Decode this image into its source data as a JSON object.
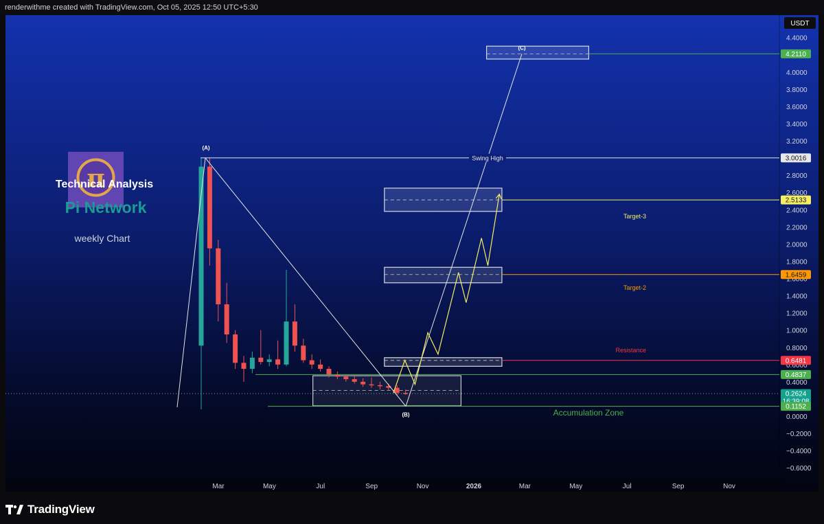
{
  "header": {
    "attribution": "renderwithme created with TradingView.com, Oct 05, 2025 12:50 UTC+5:30"
  },
  "footer": {
    "brand": "TradingView"
  },
  "overlay": {
    "title_line1": "Technical Analysis",
    "title_line2": "Pi Network",
    "subtitle": "weekly Chart",
    "logo_glyph": "π"
  },
  "colors": {
    "candle_up": "#26a69a",
    "candle_down": "#ef5350",
    "projection": "#f5ee62",
    "zone_line": "#4caf50",
    "target_box": "#d7dae3",
    "title_teal": "#1b9c92"
  },
  "chart_data": {
    "type": "candlestick",
    "currency_label": "USDT",
    "y_ticks": [
      "4.4000",
      "4.2000",
      "4.0000",
      "3.8000",
      "3.6000",
      "3.4000",
      "3.2000",
      "3.0000",
      "2.8000",
      "2.6000",
      "2.4000",
      "2.2000",
      "2.0000",
      "1.8000",
      "1.6000",
      "1.4000",
      "1.2000",
      "1.0000",
      "0.8000",
      "0.6000",
      "0.4000",
      "0.2000",
      "0.0000",
      "−0.2000",
      "−0.4000",
      "−0.6000"
    ],
    "x_ticks": [
      {
        "label": "Mar",
        "t": 0.5,
        "bold": false
      },
      {
        "label": "May",
        "t": 2.5,
        "bold": false
      },
      {
        "label": "Jul",
        "t": 4.5,
        "bold": false
      },
      {
        "label": "Sep",
        "t": 6.5,
        "bold": false
      },
      {
        "label": "Nov",
        "t": 8.5,
        "bold": false
      },
      {
        "label": "2026",
        "t": 10.5,
        "bold": true
      },
      {
        "label": "Mar",
        "t": 12.5,
        "bold": false
      },
      {
        "label": "May",
        "t": 14.5,
        "bold": false
      },
      {
        "label": "Jul",
        "t": 16.5,
        "bold": false
      },
      {
        "label": "Sep",
        "t": 18.5,
        "bold": false
      },
      {
        "label": "Nov",
        "t": 20.5,
        "bold": false
      }
    ],
    "price_tags": [
      {
        "value": 4.211,
        "label": "4.2110",
        "bg": "#4caf50",
        "fg": "#ffffff"
      },
      {
        "value": 3.0016,
        "label": "3.0016",
        "bg": "#e8e8e8",
        "fg": "#131722"
      },
      {
        "value": 2.5133,
        "label": "2.5133",
        "bg": "#f5ee62",
        "fg": "#131722"
      },
      {
        "value": 1.6459,
        "label": "1.6459",
        "bg": "#ff9800",
        "fg": "#131722"
      },
      {
        "value": 0.6481,
        "label": "0.6481",
        "bg": "#f23645",
        "fg": "#ffffff"
      },
      {
        "value": 0.4837,
        "label": "0.4837",
        "bg": "#4caf50",
        "fg": "#ffffff"
      },
      {
        "value": 0.2624,
        "label": "0.2624",
        "bg": "#14a28f",
        "fg": "#ffffff",
        "sub": "16:39:08"
      },
      {
        "value": 0.1152,
        "label": "0.1152",
        "bg": "#4caf50",
        "fg": "#ffffff"
      }
    ],
    "wave_points": [
      {
        "label": "(A)",
        "t": -0.2,
        "value": 3.0016
      },
      {
        "label": "(B)",
        "t": 6.8,
        "value": 0.1152
      },
      {
        "label": "(C)",
        "t": 11.6,
        "value": 4.211
      }
    ],
    "annotations": {
      "swing_high": "Swing High",
      "target3": "Target-3",
      "target2": "Target-2",
      "resistance": "Resistance",
      "accumulation": "Accumulation Zone"
    },
    "zones": [
      {
        "name": "target-c",
        "value": 4.211,
        "high": 4.3,
        "low": 4.15,
        "t_start": 11.0,
        "t_end": 15.0
      },
      {
        "name": "target-3",
        "value": 2.5133,
        "high": 2.65,
        "low": 2.38,
        "t_start": 7.0,
        "t_end": 11.6
      },
      {
        "name": "target-2",
        "value": 1.6459,
        "high": 1.73,
        "low": 1.55,
        "t_start": 7.0,
        "t_end": 11.6
      },
      {
        "name": "resistance",
        "value": 0.6481,
        "high": 0.68,
        "low": 0.58,
        "t_start": 7.0,
        "t_end": 11.6
      },
      {
        "name": "accumulation",
        "value": 0.3,
        "high": 0.47,
        "low": 0.12,
        "t_start": 4.2,
        "t_end": 10.0
      }
    ],
    "projection_path": [
      [
        7.35,
        0.27
      ],
      [
        7.8,
        0.65
      ],
      [
        8.2,
        0.37
      ],
      [
        8.7,
        0.97
      ],
      [
        9.1,
        0.72
      ],
      [
        9.9,
        1.67
      ],
      [
        10.2,
        1.32
      ],
      [
        10.8,
        2.07
      ],
      [
        11.05,
        1.75
      ],
      [
        11.5,
        2.58
      ]
    ],
    "candles_weekly": [
      {
        "o": 0.82,
        "h": 3.0,
        "l": 0.08,
        "c": 2.9
      },
      {
        "o": 2.9,
        "h": 3.0,
        "l": 1.75,
        "c": 1.95
      },
      {
        "o": 1.95,
        "h": 2.05,
        "l": 1.1,
        "c": 1.3
      },
      {
        "o": 1.3,
        "h": 1.55,
        "l": 0.85,
        "c": 0.95
      },
      {
        "o": 0.95,
        "h": 1.0,
        "l": 0.55,
        "c": 0.62
      },
      {
        "o": 0.62,
        "h": 0.7,
        "l": 0.4,
        "c": 0.55
      },
      {
        "o": 0.55,
        "h": 0.75,
        "l": 0.5,
        "c": 0.68
      },
      {
        "o": 0.68,
        "h": 1.0,
        "l": 0.6,
        "c": 0.63
      },
      {
        "o": 0.63,
        "h": 0.72,
        "l": 0.58,
        "c": 0.66
      },
      {
        "o": 0.66,
        "h": 0.88,
        "l": 0.55,
        "c": 0.6
      },
      {
        "o": 0.6,
        "h": 1.7,
        "l": 0.58,
        "c": 1.1
      },
      {
        "o": 1.1,
        "h": 1.3,
        "l": 0.75,
        "c": 0.82
      },
      {
        "o": 0.82,
        "h": 0.9,
        "l": 0.62,
        "c": 0.65
      },
      {
        "o": 0.65,
        "h": 0.72,
        "l": 0.55,
        "c": 0.6
      },
      {
        "o": 0.6,
        "h": 0.66,
        "l": 0.52,
        "c": 0.55
      },
      {
        "o": 0.55,
        "h": 0.58,
        "l": 0.45,
        "c": 0.48
      },
      {
        "o": 0.48,
        "h": 0.52,
        "l": 0.43,
        "c": 0.46
      },
      {
        "o": 0.46,
        "h": 0.48,
        "l": 0.4,
        "c": 0.43
      },
      {
        "o": 0.43,
        "h": 0.47,
        "l": 0.38,
        "c": 0.4
      },
      {
        "o": 0.4,
        "h": 0.44,
        "l": 0.34,
        "c": 0.37
      },
      {
        "o": 0.37,
        "h": 0.45,
        "l": 0.33,
        "c": 0.36
      },
      {
        "o": 0.36,
        "h": 0.4,
        "l": 0.31,
        "c": 0.35
      },
      {
        "o": 0.35,
        "h": 0.38,
        "l": 0.3,
        "c": 0.33
      },
      {
        "o": 0.33,
        "h": 0.36,
        "l": 0.24,
        "c": 0.27
      },
      {
        "o": 0.27,
        "h": 0.31,
        "l": 0.25,
        "c": 0.26
      }
    ]
  }
}
